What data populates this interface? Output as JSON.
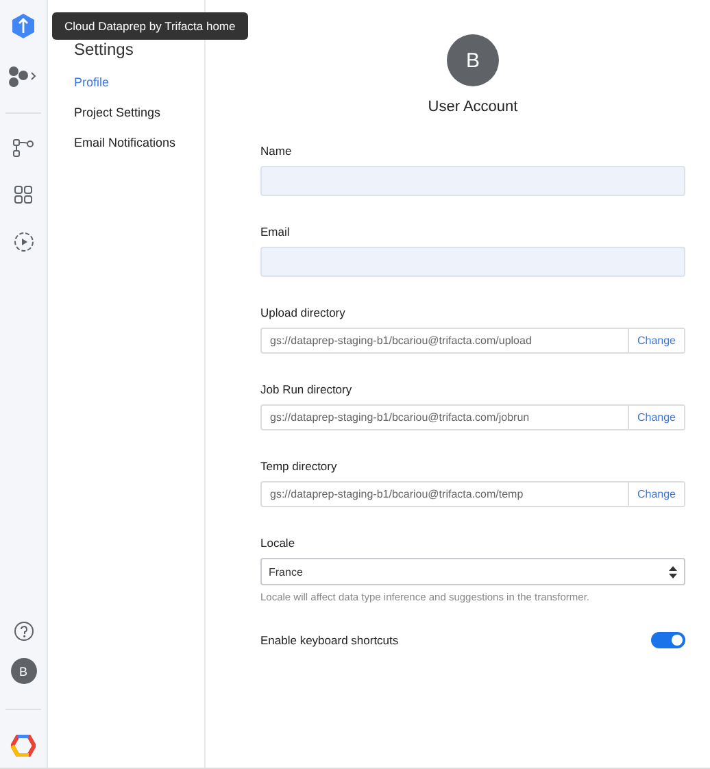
{
  "tooltip": "Cloud Dataprep by Trifacta home",
  "sidebar": {
    "title": "Settings",
    "items": [
      {
        "label": "Profile",
        "selected": true
      },
      {
        "label": "Project Settings",
        "selected": false
      },
      {
        "label": "Email Notifications",
        "selected": false
      }
    ]
  },
  "rail": {
    "avatar": "B"
  },
  "account": {
    "avatar": "B",
    "title": "User Account"
  },
  "fields": [
    {
      "kind": "text",
      "label": "Name"
    },
    {
      "kind": "text",
      "label": "Email"
    },
    {
      "kind": "dir",
      "label": "Upload directory",
      "value": "gs://dataprep-staging-b1/bcariou@trifacta.com/upload",
      "button": "Change"
    },
    {
      "kind": "dir",
      "label": "Job Run directory",
      "value": "gs://dataprep-staging-b1/bcariou@trifacta.com/jobrun",
      "button": "Change"
    },
    {
      "kind": "dir",
      "label": "Temp directory",
      "value": "gs://dataprep-staging-b1/bcariou@trifacta.com/temp",
      "button": "Change"
    },
    {
      "kind": "select",
      "label": "Locale",
      "value": "France",
      "hint": "Locale will affect data type inference and suggestions in the transformer."
    }
  ],
  "shortcuts": {
    "label": "Enable keyboard shortcuts",
    "on": true
  }
}
